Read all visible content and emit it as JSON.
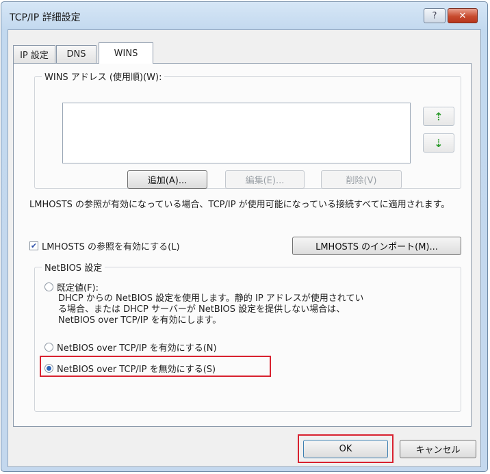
{
  "window": {
    "title": "TCP/IP 詳細設定",
    "help_label": "?",
    "close_label": "✕"
  },
  "tabs": [
    {
      "label": "IP 設定"
    },
    {
      "label": "DNS"
    },
    {
      "label": "WINS",
      "selected": true
    }
  ],
  "wins": {
    "group_label": "WINS アドレス (使用順)(W):",
    "addresses": [],
    "up_icon": "arrow-up-icon",
    "down_icon": "arrow-down-icon",
    "add_label": "追加(A)...",
    "edit_label": "編集(E)...",
    "delete_label": "削除(V)"
  },
  "lmhosts": {
    "description": "LMHOSTS の参照が有効になっている場合、TCP/IP が使用可能になっている接続すべてに適用されます。",
    "checkbox_label": "LMHOSTS の参照を有効にする(L)",
    "checked": true,
    "import_label": "LMHOSTS のインポート(M)..."
  },
  "netbios": {
    "group_label": "NetBIOS 設定",
    "default_label": "既定値(F):",
    "default_desc_line1": "DHCP からの NetBIOS 設定を使用します。静的 IP アドレスが使用されてい",
    "default_desc_line2": "る場合、または DHCP サーバーが NetBIOS 設定を提供しない場合は、",
    "default_desc_line3": "NetBIOS over TCP/IP を有効にします。",
    "enable_label": "NetBIOS over TCP/IP を有効にする(N)",
    "disable_label": "NetBIOS over TCP/IP を無効にする(S)",
    "selected": "disable"
  },
  "footer": {
    "ok_label": "OK",
    "cancel_label": "キャンセル"
  },
  "colors": {
    "highlight": "#d8212f",
    "accent": "#2e66b8"
  }
}
